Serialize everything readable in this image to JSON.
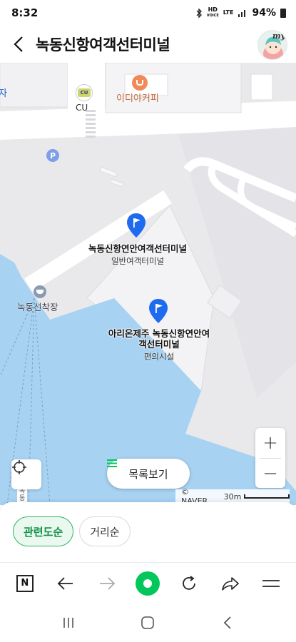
{
  "status": {
    "time": "8:32",
    "hd_line1": "HD",
    "hd_line2": "VOICE",
    "lte": "LTE",
    "battery": "94%"
  },
  "header": {
    "title": "녹동신항여객선터미널",
    "avatar_text": "my"
  },
  "map": {
    "labels": {
      "cut_left": "자",
      "cu_logo": "CU",
      "cu": "CU",
      "cafe": "이디야커피",
      "parking": "P",
      "pier": "녹동선착장",
      "vertical_road": "녹\n동"
    },
    "pois": [
      {
        "name": "녹동신항연안여객선터미널",
        "category": "일반여객터미널"
      },
      {
        "name": "아리온제주 녹동신항연안여객선터미널",
        "category": "편의시설"
      }
    ],
    "list_button": "목록보기",
    "zoom_in": "+",
    "zoom_out": "−",
    "credit": "© NAVER",
    "scale": "30m"
  },
  "sort": {
    "options": [
      {
        "label": "관련도순",
        "active": true
      },
      {
        "label": "거리순",
        "active": false
      }
    ]
  },
  "browser": {
    "naver_logo": "N"
  },
  "colors": {
    "accent": "#03c75a",
    "pin": "#1e6bf0",
    "water": "#a8d2f2",
    "chip_active": "#13924a"
  }
}
